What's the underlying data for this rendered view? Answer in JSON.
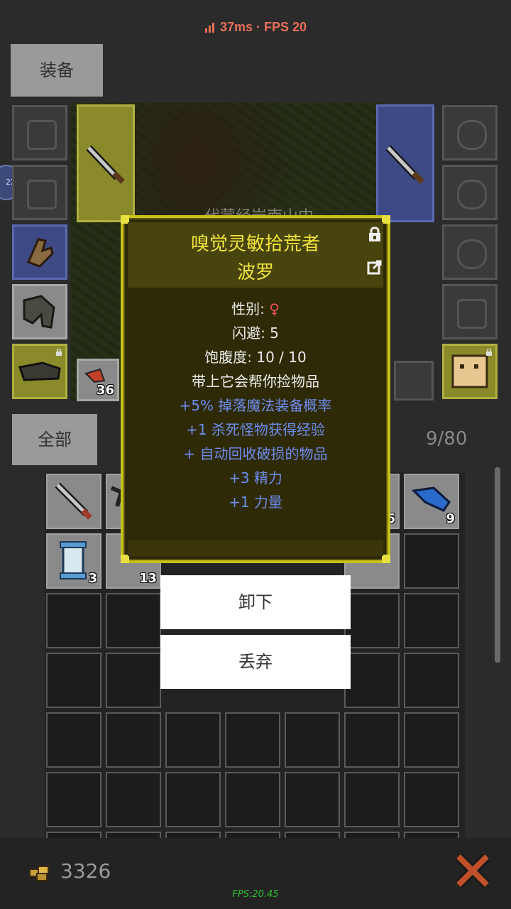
{
  "network": {
    "status_text": "37ms · FPS 20"
  },
  "equip_tab": {
    "label": "装备"
  },
  "scene": {
    "location_text": "代蒙经岩南山中"
  },
  "quickslot": {
    "qty": "36"
  },
  "side_badge": "22",
  "filter_tab": {
    "label": "全部"
  },
  "inventory": {
    "count": "9/80",
    "items": [
      {
        "icon": "sword-icon",
        "qty": ""
      },
      {
        "icon": "weapon-icon",
        "qty": ""
      },
      {
        "icon": "item-icon",
        "qty": "6"
      },
      {
        "icon": "blue-feather-icon",
        "qty": "9"
      },
      {
        "icon": "scroll-icon",
        "qty": "3"
      },
      {
        "icon": "item-icon",
        "qty": "13"
      }
    ]
  },
  "tooltip": {
    "title": "嗅觉灵敏拾荒者",
    "name": "波罗",
    "gender_label": "性别: ",
    "gender_value": "♀",
    "dodge": "闪避: 5",
    "satiety": "饱腹度: 10 / 10",
    "desc": "带上它会帮你捡物品",
    "bonuses": [
      "+5% 掉落魔法装备概率",
      "+1 杀死怪物获得经验",
      "+ 自动回收破损的物品",
      "+3 精力",
      "+1 力量"
    ]
  },
  "context_menu": {
    "unequip": "卸下",
    "discard": "丢弃"
  },
  "footer": {
    "gold": "3326",
    "fps": "FPS:20.45"
  },
  "colors": {
    "tooltip_border": "#c8c218",
    "tooltip_title": "#f2e63a",
    "bonus_text": "#6e8cf0",
    "gender_female": "#e8505a",
    "fps_green": "#30c030"
  }
}
